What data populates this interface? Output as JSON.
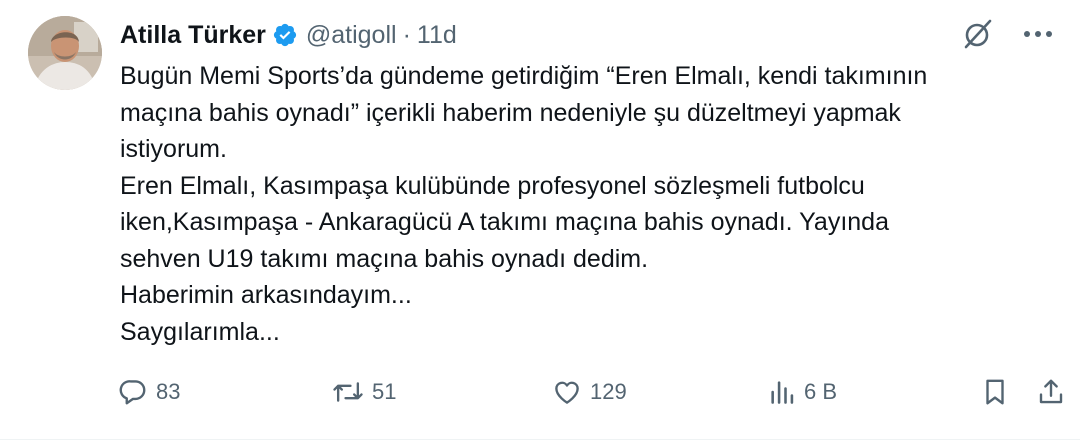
{
  "author": {
    "display_name": "Atilla Türker",
    "handle": "@atigoll",
    "separator": "·",
    "time": "11d",
    "verified_color": "#1d9bf0"
  },
  "tweet": {
    "lines": [
      "Bugün Memi Sports’da gündeme getirdiğim “Eren Elmalı, kendi takımının",
      "maçına bahis oynadı” içerikli haberim nedeniyle şu düzeltmeyi yapmak",
      "istiyorum.",
      "Eren Elmalı, Kasımpaşa kulübünde profesyonel sözleşmeli futbolcu",
      "iken,Kasımpaşa - Ankaragücü A takımı maçına bahis oynadı. Yayında",
      "sehven U19 takımı maçına bahis oynadı dedim.",
      "Haberimin arkasındayım...",
      "Saygılarımla..."
    ]
  },
  "top_icons": [
    "grok-icon",
    "more-icon"
  ],
  "actions": {
    "reply_count": "83",
    "repost_count": "51",
    "like_count": "129",
    "views_count": "6 B"
  },
  "colors": {
    "text": "#0f1419",
    "secondary": "#536471",
    "accent": "#1d9bf0"
  }
}
